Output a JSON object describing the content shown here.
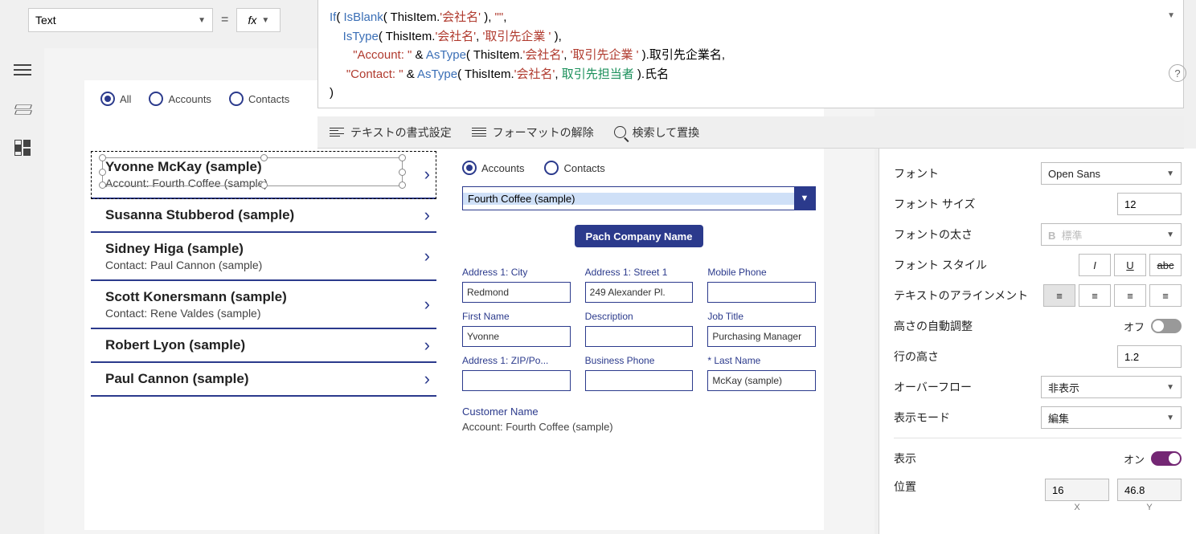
{
  "prop": {
    "name": "Text",
    "equals": "="
  },
  "formula": {
    "l1a": "If",
    "l1b": "( ",
    "l1c": "IsBlank",
    "l1d": "( ThisItem.",
    "l1e": "'会社名'",
    "l1f": " ), ",
    "l1g": "\"\"",
    "l1h": ",",
    "l2a": "    ",
    "l2b": "IsType",
    "l2c": "( ThisItem.",
    "l2d": "'会社名'",
    "l2e": ", ",
    "l2f": "'取引先企業 '",
    "l2g": " ),",
    "l3a": "       ",
    "l3b": "\"Account: \"",
    "l3c": " & ",
    "l3d": "AsType",
    "l3e": "( ThisItem.",
    "l3f": "'会社名'",
    "l3g": ", ",
    "l3h": "'取引先企業 '",
    "l3i": " ).取引先企業名,",
    "l4a": "     ",
    "l4b": "\"Contact: \"",
    "l4c": " & ",
    "l4d": "AsType",
    "l4e": "( ThisItem.",
    "l4f": "'会社名'",
    "l4g": ", ",
    "l4h": "取引先担当者",
    "l4i": " ).氏名",
    "l5": ")"
  },
  "formula_toolbar": {
    "format": "テキストの書式設定",
    "remove": "フォーマットの解除",
    "find": "検索して置換"
  },
  "top_radios": {
    "all": "All",
    "accounts": "Accounts",
    "contacts": "Contacts"
  },
  "gallery": [
    {
      "title": "Yvonne McKay (sample)",
      "sub": "Account: Fourth Coffee (sample)"
    },
    {
      "title": "Susanna Stubberod (sample)",
      "sub": ""
    },
    {
      "title": "Sidney Higa (sample)",
      "sub": "Contact: Paul Cannon (sample)"
    },
    {
      "title": "Scott Konersmann (sample)",
      "sub": "Contact: Rene Valdes (sample)"
    },
    {
      "title": "Robert Lyon (sample)",
      "sub": ""
    },
    {
      "title": "Paul Cannon (sample)",
      "sub": ""
    }
  ],
  "form": {
    "radios": {
      "accounts": "Accounts",
      "contacts": "Contacts"
    },
    "combo": "Fourth Coffee (sample)",
    "button": "Pach Company Name",
    "fields": [
      {
        "label": "Address 1: City",
        "value": "Redmond"
      },
      {
        "label": "Address 1: Street 1",
        "value": "249 Alexander Pl."
      },
      {
        "label": "Mobile Phone",
        "value": ""
      },
      {
        "label": "First Name",
        "value": "Yvonne"
      },
      {
        "label": "Description",
        "value": ""
      },
      {
        "label": "Job Title",
        "value": "Purchasing Manager"
      },
      {
        "label": "Address 1: ZIP/Po...",
        "value": ""
      },
      {
        "label": "Business Phone",
        "value": ""
      },
      {
        "label": "*  Last Name",
        "value": "McKay (sample)"
      }
    ],
    "customer_label": "Customer Name",
    "customer_value": "Account: Fourth Coffee (sample)"
  },
  "props": {
    "font_label": "フォント",
    "font_value": "Open Sans",
    "fontsize_label": "フォント サイズ",
    "fontsize_value": "12",
    "weight_label": "フォントの太さ",
    "weight_value": "標準",
    "style_label": "フォント スタイル",
    "align_label": "テキストのアラインメント",
    "autoh_label": "高さの自動調整",
    "autoh_state": "オフ",
    "lineh_label": "行の高さ",
    "lineh_value": "1.2",
    "overflow_label": "オーバーフロー",
    "overflow_value": "非表示",
    "mode_label": "表示モード",
    "mode_value": "編集",
    "visible_label": "表示",
    "visible_state": "オン",
    "pos_label": "位置",
    "pos_x": "16",
    "pos_y": "46.8",
    "pos_xl": "X",
    "pos_yl": "Y"
  }
}
